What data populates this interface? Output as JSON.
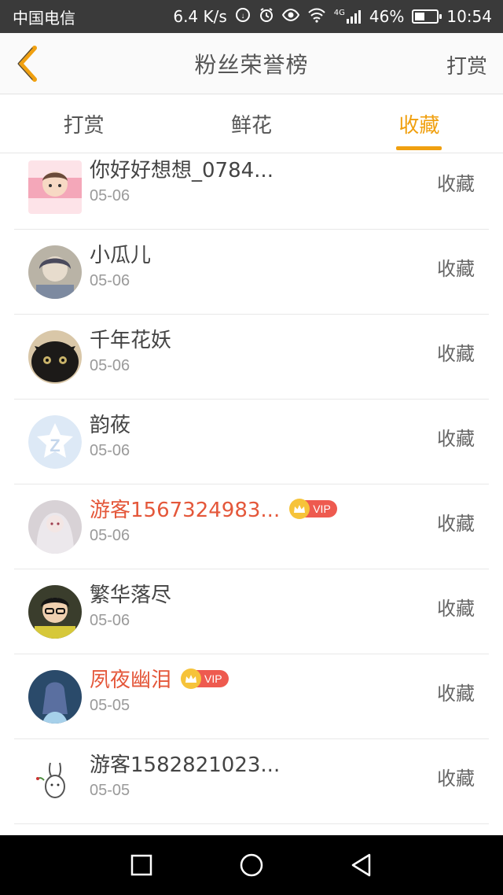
{
  "status_bar": {
    "carrier": "中国电信",
    "speed": "6.4 K/s",
    "network": "4G",
    "battery": "46%",
    "battery_level": 0.46,
    "time": "10:54"
  },
  "header": {
    "title": "粉丝荣誉榜",
    "action": "打赏"
  },
  "tabs": [
    {
      "label": "打赏",
      "active": false
    },
    {
      "label": "鲜花",
      "active": false
    },
    {
      "label": "收藏",
      "active": true
    }
  ],
  "vip_label": "VIP",
  "rows": [
    {
      "name": "你好好想想_0784...",
      "date": "05-06",
      "action": "收藏",
      "vip": false
    },
    {
      "name": "小瓜儿",
      "date": "05-06",
      "action": "收藏",
      "vip": false
    },
    {
      "name": "千年花妖",
      "date": "05-06",
      "action": "收藏",
      "vip": false
    },
    {
      "name": "韵莜",
      "date": "05-06",
      "action": "收藏",
      "vip": false
    },
    {
      "name": "游客1567324983...",
      "date": "05-06",
      "action": "收藏",
      "vip": true
    },
    {
      "name": "繁华落尽",
      "date": "05-06",
      "action": "收藏",
      "vip": false
    },
    {
      "name": "夙夜幽泪",
      "date": "05-05",
      "action": "收藏",
      "vip": true
    },
    {
      "name": "游客1582821023...",
      "date": "05-05",
      "action": "收藏",
      "vip": false
    }
  ],
  "colors": {
    "accent": "#f0a010",
    "vip_name": "#e4573a",
    "vip_badge": "#ee5a4f"
  }
}
